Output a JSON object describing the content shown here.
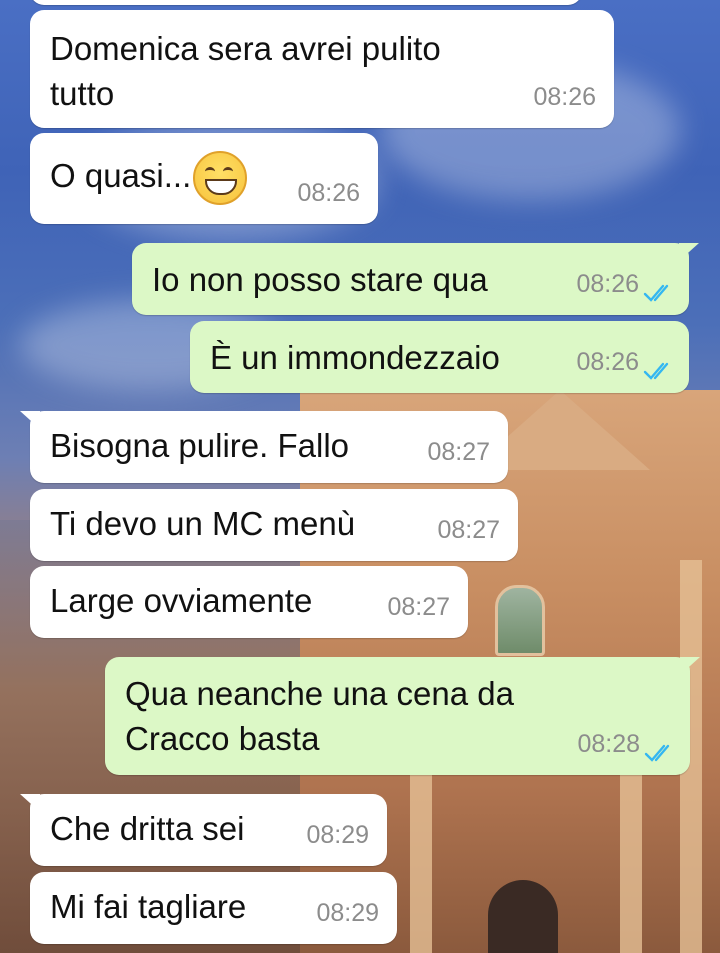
{
  "colors": {
    "incoming_bubble": "#ffffff",
    "outgoing_bubble": "#dcf8c6",
    "read_ticks": "#34b7f1",
    "timestamp": "#8c8c8c"
  },
  "messages": [
    {
      "direction": "in",
      "text": "Domenica sera avrei pulito\ntutto",
      "time": "08:26"
    },
    {
      "direction": "in",
      "text": "O quasi...",
      "emoji": "grinning-face-icon",
      "time": "08:26"
    },
    {
      "direction": "out",
      "text": "Io non posso stare qua",
      "time": "08:26",
      "status": "read"
    },
    {
      "direction": "out",
      "text": "È un immondezzaio",
      "time": "08:26",
      "status": "read"
    },
    {
      "direction": "in",
      "text": "Bisogna pulire. Fallo",
      "time": "08:27"
    },
    {
      "direction": "in",
      "text": "Ti devo un MC menù",
      "time": "08:27"
    },
    {
      "direction": "in",
      "text": "Large ovviamente",
      "time": "08:27"
    },
    {
      "direction": "out",
      "text": "Qua neanche una cena da\nCracco basta",
      "time": "08:28",
      "status": "read"
    },
    {
      "direction": "in",
      "text": "Che dritta sei",
      "time": "08:29"
    },
    {
      "direction": "in",
      "text": "Mi fai tagliare",
      "time": "08:29"
    }
  ]
}
